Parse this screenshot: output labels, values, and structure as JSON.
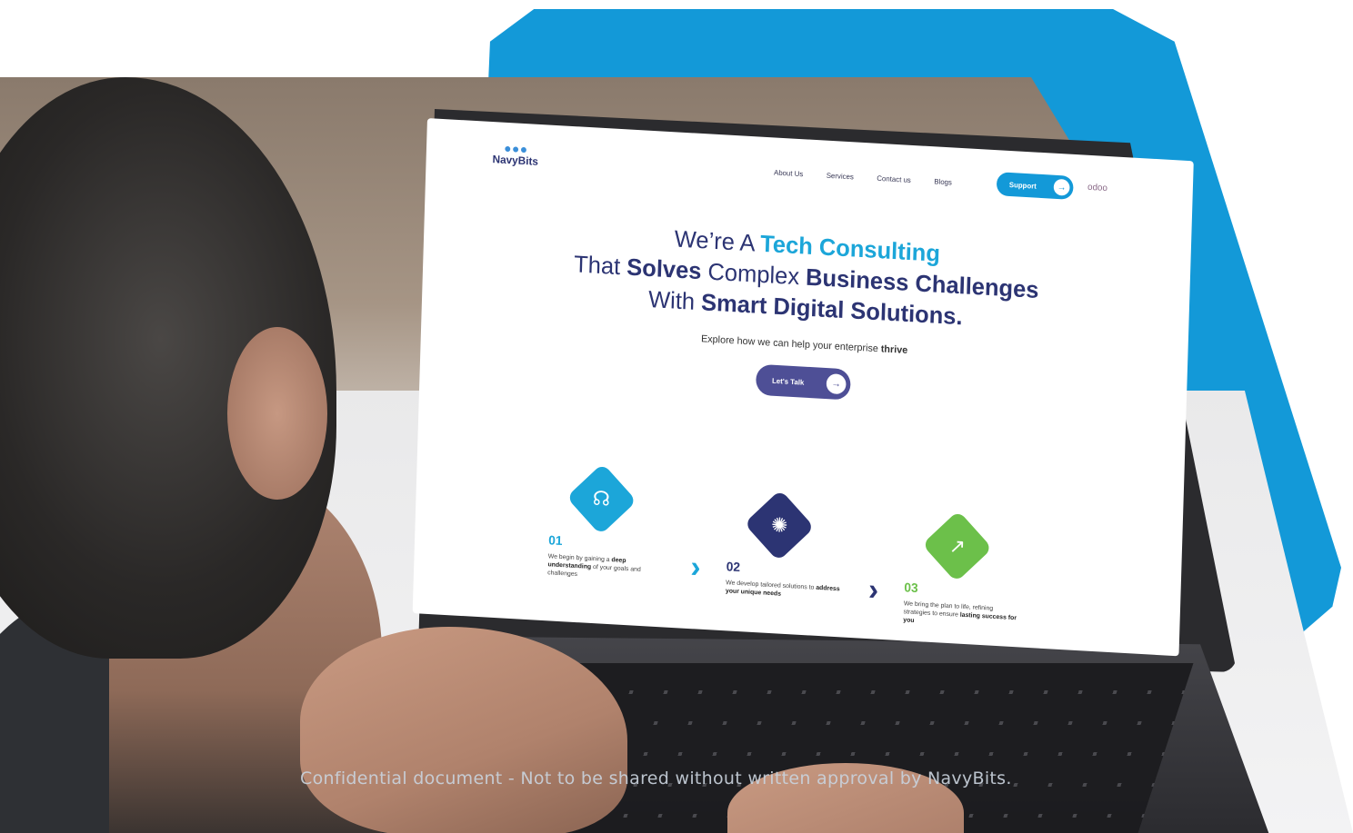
{
  "brand": {
    "name": "NavyBits",
    "primary": "#1399d8",
    "navy": "#2c3473",
    "purple": "#4e4f96"
  },
  "nav": {
    "links": [
      "About Us",
      "Services",
      "Contact us",
      "Blogs"
    ],
    "support_label": "Support",
    "odoo": "odoo"
  },
  "hero": {
    "line1_pre": "We’re A ",
    "line1_accent": "Tech Consulting",
    "line2_pre": "That ",
    "line2_b1": "Solves",
    "line2_mid": " Complex ",
    "line2_b2": "Business Challenges",
    "line3_pre": "With ",
    "line3_b": "Smart Digital Solutions.",
    "subtitle_pre": "Explore how we can help your enterprise ",
    "subtitle_b": "thrive",
    "cta_label": "Let's Talk"
  },
  "steps": [
    {
      "num": "01",
      "color": "#1ca6d9",
      "icon": "headset-icon",
      "glyph": "☊",
      "text_pre": "We begin by gaining a ",
      "text_b": "deep understanding",
      "text_post": " of your goals and challenges"
    },
    {
      "num": "02",
      "color": "#2c3473",
      "icon": "bulb-icon",
      "glyph": "✺",
      "text_pre": "We develop tailored solutions to ",
      "text_b": "address your unique needs",
      "text_post": ""
    },
    {
      "num": "03",
      "color": "#6cc04a",
      "icon": "growth-chart-icon",
      "glyph": "↗",
      "text_pre": "We bring the plan to life, refining strategies to ensure ",
      "text_b": "lasting success for you",
      "text_post": ""
    }
  ],
  "footer": {
    "note": "Confidential document - Not to be shared without written approval by NavyBits."
  }
}
